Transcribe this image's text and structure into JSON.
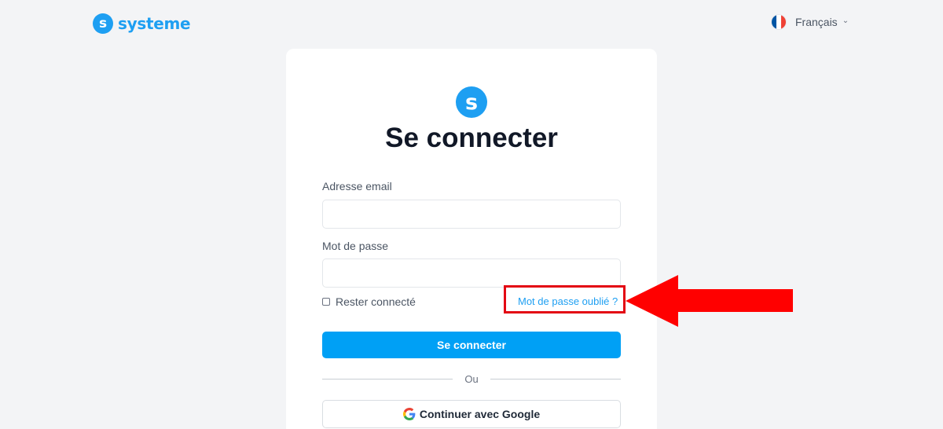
{
  "header": {
    "brand_letter": "s",
    "brand_name": "systeme",
    "language": "Français",
    "flag_colors": [
      "#0055a4",
      "#ffffff",
      "#ef4135"
    ]
  },
  "login_card": {
    "logo_letter": "s",
    "title": "Se connecter",
    "email_label": "Adresse email",
    "email_value": "",
    "password_label": "Mot de passe",
    "password_value": "",
    "remember_label": "Rester connecté",
    "remember_checked": false,
    "forgot_link": "Mot de passe oublié ?",
    "submit_label": "Se connecter",
    "divider_text": "Ou",
    "google_label": "Continuer avec Google"
  },
  "annotation": {
    "highlight_color": "#e30613",
    "arrow_color": "#ff0000",
    "arrow_direction": "left",
    "target": "Mot de passe oublié ?"
  },
  "colors": {
    "brand": "#1e9ff2",
    "primary_button": "#00a0f5",
    "background": "#f3f4f6"
  }
}
